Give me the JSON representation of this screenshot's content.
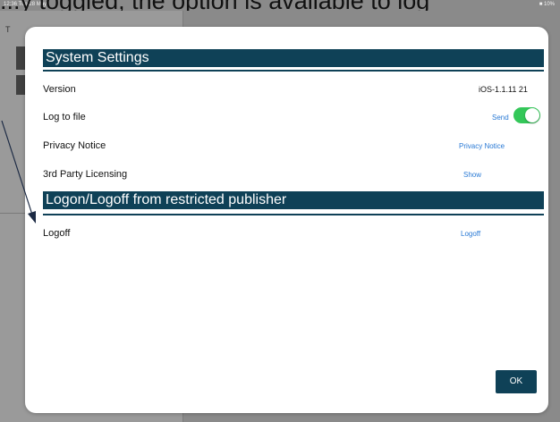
{
  "caption": {
    "text": "...y toggled, the option is available to log"
  },
  "statusbar": {
    "time": "12:36  Tue 28 May",
    "right": "■ 10%"
  },
  "background": {
    "title_letter": "T"
  },
  "settings": {
    "section1_title": "System Settings",
    "version_label": "Version",
    "version_value": "iOS-1.1.11 21",
    "log_label": "Log to file",
    "send_label": "Send",
    "privacy_label": "Privacy Notice",
    "privacy_link": "Privacy Notice",
    "licensing_label": "3rd Party Licensing",
    "licensing_link": "Show",
    "section2_title": "Logon/Logoff from restricted publisher",
    "logoff_label": "Logoff",
    "logoff_link": "Logoff",
    "ok_label": "OK",
    "log_toggle_on": true
  },
  "colors": {
    "header": "#0f4157",
    "link": "#2a7ad5",
    "toggle_on": "#34c759"
  }
}
